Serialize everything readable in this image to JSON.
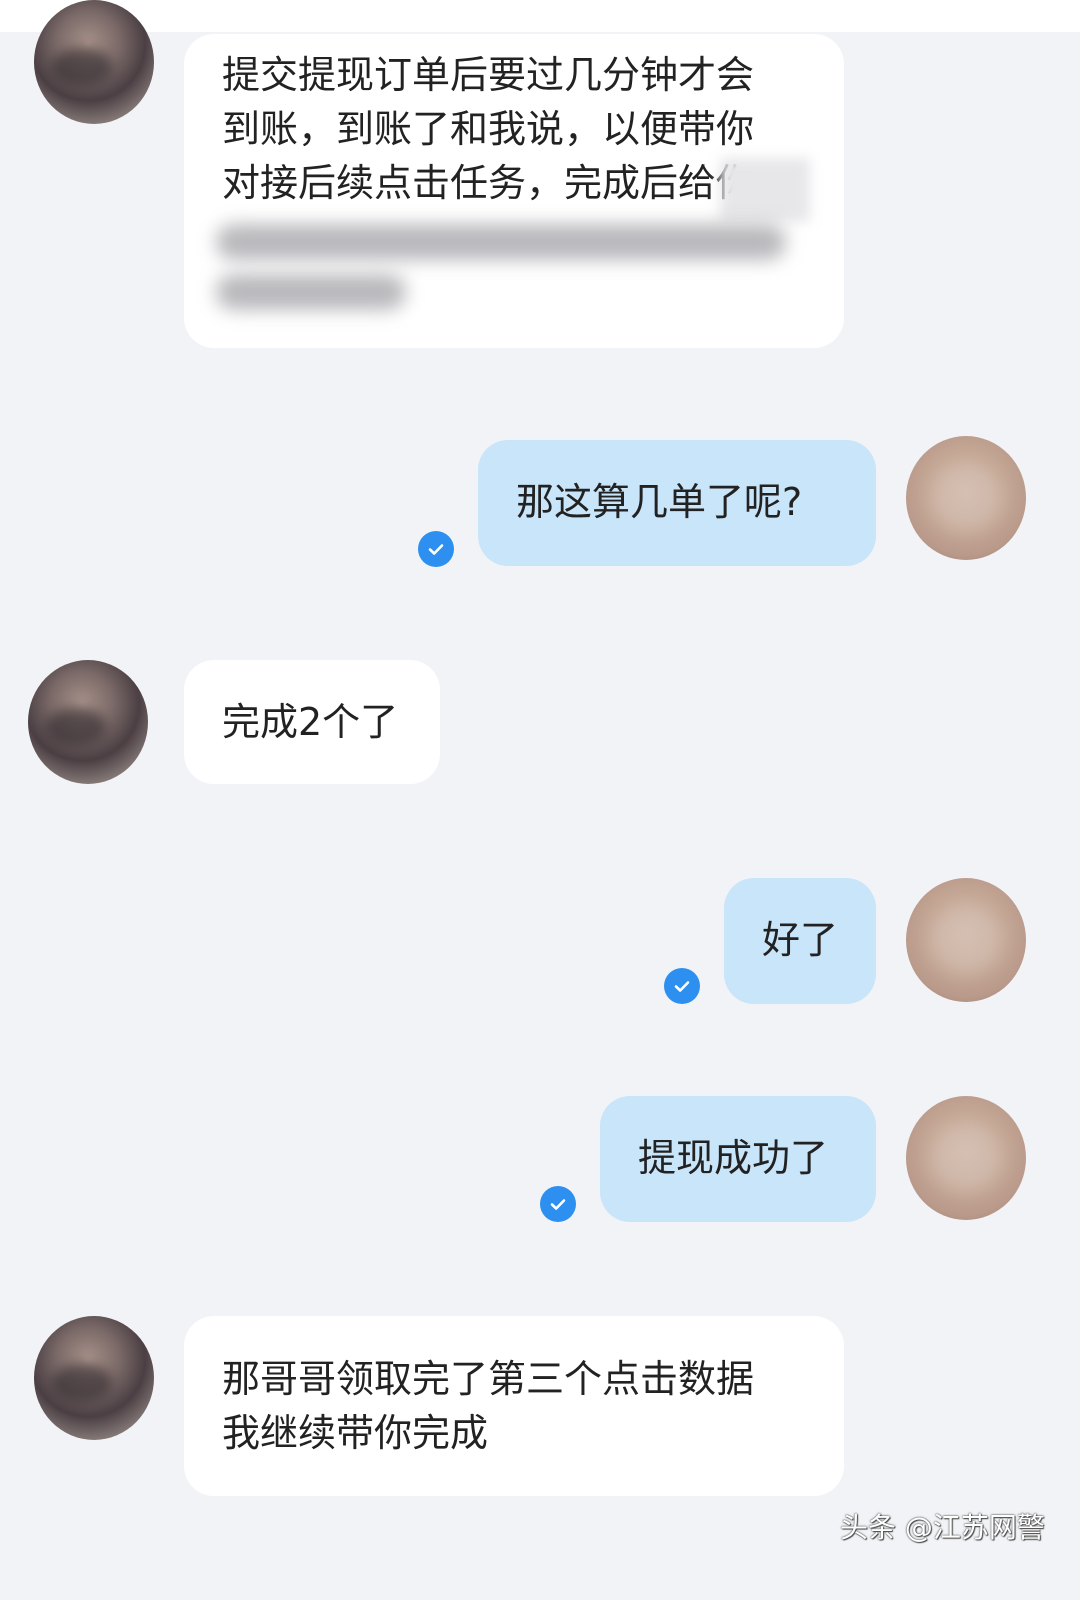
{
  "messages": [
    {
      "sender": "contact",
      "lines": [
        "提交提现订单后要过几分钟才会",
        "到账，到账了和我说，以便带你",
        "对接后续点击任务，完成后给你"
      ]
    },
    {
      "sender": "me",
      "text": "那这算几单了呢?",
      "read": true
    },
    {
      "sender": "contact",
      "text": "完成2个了"
    },
    {
      "sender": "me",
      "text": "好了",
      "read": true
    },
    {
      "sender": "me",
      "text": "提现成功了",
      "read": true
    },
    {
      "sender": "contact",
      "lines": [
        "那哥哥领取完了第三个点击数据",
        "我继续带你完成"
      ]
    }
  ],
  "watermark": "头条 @江苏网警",
  "icons": {
    "read_receipt": "checkmark-circle-icon",
    "avatar": "blurred-avatar"
  },
  "colors": {
    "background": "#f2f3f7",
    "incoming_bubble": "#ffffff",
    "outgoing_bubble": "#c8e5fa",
    "check": "#2d8ff0"
  }
}
